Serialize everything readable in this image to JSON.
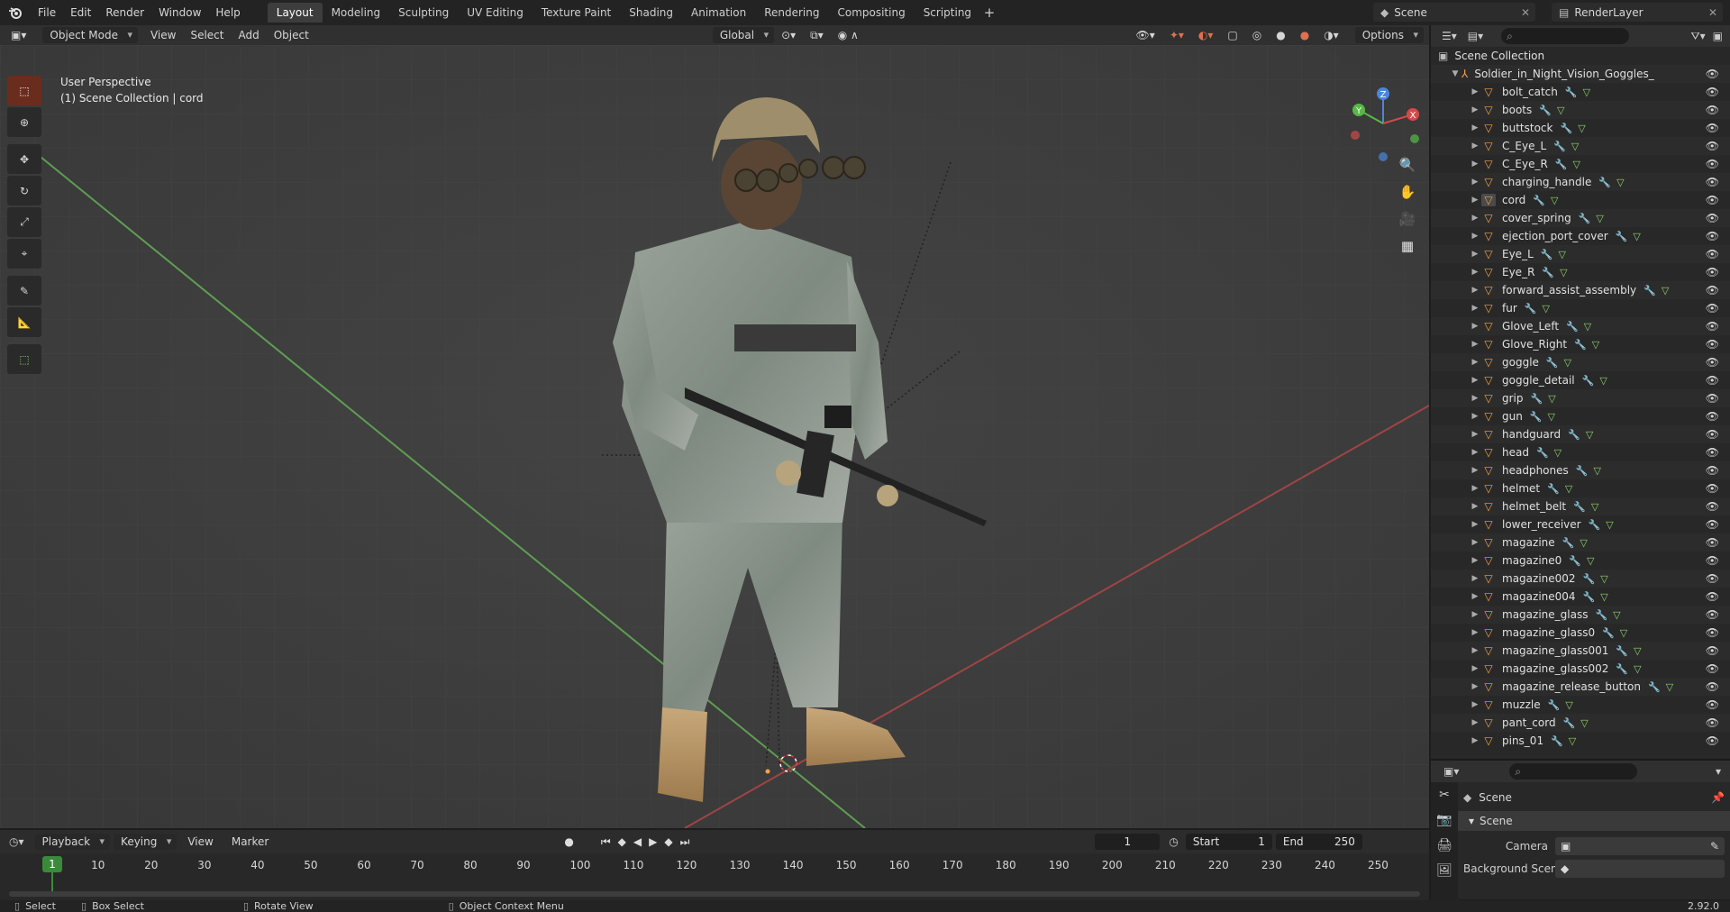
{
  "topbar": {
    "menus": [
      "File",
      "Edit",
      "Render",
      "Window",
      "Help"
    ],
    "workspaces": [
      "Layout",
      "Modeling",
      "Sculpting",
      "UV Editing",
      "Texture Paint",
      "Shading",
      "Animation",
      "Rendering",
      "Compositing",
      "Scripting"
    ],
    "active_workspace": "Layout",
    "scene": "Scene",
    "view_layer": "RenderLayer"
  },
  "viewport": {
    "mode": "Object Mode",
    "menus": [
      "View",
      "Select",
      "Add",
      "Object"
    ],
    "transform_orientation": "Global",
    "options_label": "Options",
    "info_line1": "User Perspective",
    "info_line2": "(1) Scene Collection | cord",
    "gizmo_axes": {
      "x": "X",
      "y": "Y",
      "z": "Z"
    }
  },
  "outliner": {
    "root": "Scene Collection",
    "collection": "Soldier_in_Night_Vision_Goggles_Grey_Camo",
    "active_object": "cord",
    "objects": [
      "bolt_catch",
      "boots",
      "buttstock",
      "C_Eye_L",
      "C_Eye_R",
      "charging_handle",
      "cord",
      "cover_spring",
      "ejection_port_cover",
      "Eye_L",
      "Eye_R",
      "forward_assist_assembly",
      "fur",
      "Glove_Left",
      "Glove_Right",
      "goggle",
      "goggle_detail",
      "grip",
      "gun",
      "handguard",
      "head",
      "headphones",
      "helmet",
      "helmet_belt",
      "lower_receiver",
      "magazine",
      "magazine0",
      "magazine002",
      "magazine004",
      "magazine_glass",
      "magazine_glass0",
      "magazine_glass001",
      "magazine_glass002",
      "magazine_release_button",
      "muzzle",
      "pant_cord",
      "pins_01"
    ]
  },
  "properties": {
    "context": "Scene",
    "panel": "Scene",
    "camera_label": "Camera",
    "background_label": "Background Scene"
  },
  "timeline": {
    "menus": [
      "Playback",
      "Keying",
      "View",
      "Marker"
    ],
    "current_frame": "1",
    "start_label": "Start",
    "start": "1",
    "end_label": "End",
    "end": "250",
    "ticks": [
      "1",
      "10",
      "20",
      "30",
      "40",
      "50",
      "60",
      "70",
      "80",
      "90",
      "100",
      "110",
      "120",
      "130",
      "140",
      "150",
      "160",
      "170",
      "180",
      "190",
      "200",
      "210",
      "220",
      "230",
      "240",
      "250"
    ]
  },
  "statusbar": {
    "select": "Select",
    "box_select": "Box Select",
    "rotate_view": "Rotate View",
    "context_menu": "Object Context Menu",
    "version": "2.92.0"
  },
  "colors": {
    "accent": "#f3a14a",
    "active_tool": "#6a2c1d",
    "frame_marker": "#3b8a3c",
    "x_axis": "#d24a4a",
    "y_axis": "#58b847",
    "z_axis": "#4a86e0"
  }
}
